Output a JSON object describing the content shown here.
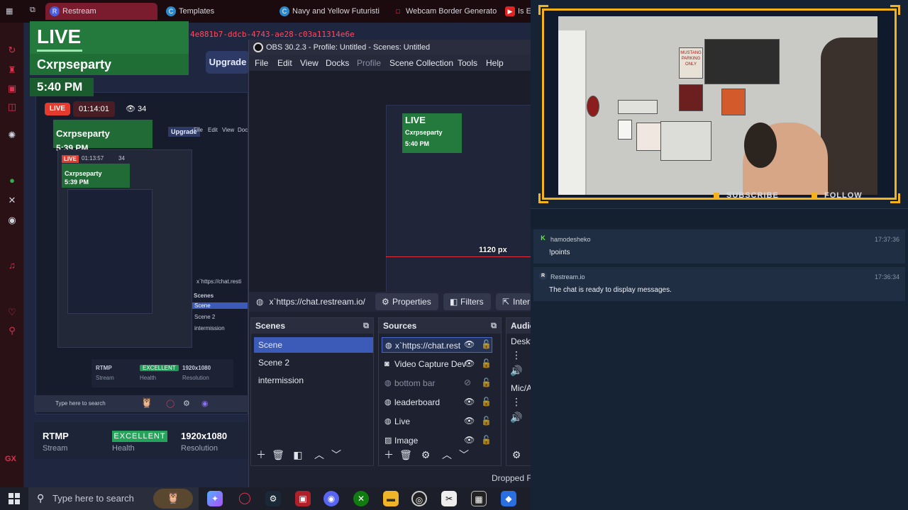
{
  "browser": {
    "tabs": [
      {
        "label": "Restream",
        "icon": "R"
      },
      {
        "label": "Templates",
        "icon": "C"
      },
      {
        "label": "Navy and Yellow Futuristi",
        "icon": "C"
      },
      {
        "label": "Webcam Border Generato",
        "icon": "□"
      },
      {
        "label": "Is E",
        "icon": "▶"
      }
    ],
    "url_fragment": "4e881b7-ddcb-4743-ae28-c03a11314e6e",
    "upgrade_label": "Upgrade"
  },
  "live_overlay": {
    "live_word": "LIVE",
    "channel": "Cxrpseparty",
    "time": "5:40 PM"
  },
  "nested": {
    "live_badge": "LIVE",
    "timer": "01:14:01",
    "viewers": "34",
    "channel": "Cxrpseparty",
    "time": "5:39 PM",
    "upgrade_label": "Upgrade",
    "menu": [
      "File",
      "Edit",
      "View",
      "Dock"
    ],
    "inner_timer": "01:13:57",
    "inner_viewers": "34",
    "inner_live": "LIVE",
    "inner_channel": "Cxrpseparty",
    "inner_time": "5:39 PM",
    "inner_source": "x`https://chat.resti",
    "inner_scenes_title": "Scenes",
    "inner_scenes": [
      "Scene",
      "Scene 2",
      "intermission"
    ],
    "rtmp": "RTMP",
    "stream": "Stream",
    "excellent": "EXCELLENT",
    "health": "Health",
    "resolution_value": "1920x1080",
    "resolution": "Resolution",
    "search": "Type here to search"
  },
  "stats": {
    "rtmp": "RTMP",
    "stream": "Stream",
    "excellent": "EXCELLENT",
    "health": "Health",
    "resolution_value": "1920x1080",
    "resolution": "Resolution"
  },
  "obs": {
    "title": "OBS 30.2.3 - Profile: Untitled - Scenes: Untitled",
    "menu": [
      "File",
      "Edit",
      "View",
      "Docks",
      "Profile",
      "Scene Collection",
      "Tools",
      "Help"
    ],
    "preview": {
      "live": "LIVE",
      "channel": "Cxrpseparty",
      "time": "5:40 PM",
      "size_label": "1120 px"
    },
    "selected_source": "x`https://chat.restream.io/",
    "properties_label": "Properties",
    "filters_label": "Filters",
    "interact_label": "Inter",
    "scenes_title": "Scenes",
    "scenes": [
      "Scene",
      "Scene 2",
      "intermission"
    ],
    "sources_title": "Sources",
    "sources": [
      {
        "label": "x`https://chat.rest",
        "icon": "globe"
      },
      {
        "label": "Video Capture Dev",
        "icon": "camera"
      },
      {
        "label": "bottom bar",
        "icon": "globe"
      },
      {
        "label": "leaderboard",
        "icon": "globe"
      },
      {
        "label": "Live",
        "icon": "globe"
      },
      {
        "label": "Image",
        "icon": "image"
      }
    ],
    "audio_title": "Audio",
    "audio_desktop": "Deskt",
    "audio_mic": "Mic/A",
    "dropped_frames": "Dropped Fi"
  },
  "taskbar": {
    "search_placeholder": "Type here to search"
  },
  "cam": {
    "subscribe": "SUBSCRIBE",
    "follow": "FOLLOW",
    "poster_text": "MUSTANG PARKING ONLY"
  },
  "chat": {
    "messages": [
      {
        "user": "hamodesheko",
        "time": "17:37:36",
        "text": "!points",
        "badge": "K"
      },
      {
        "user": "Restream.io",
        "time": "17:36:34",
        "text": "The chat is ready to display messages.",
        "badge": "R"
      }
    ]
  },
  "colors": {
    "accent_obs": "#3c5bb8",
    "live_green": "#237a3c",
    "cam_border": "#f5b21b",
    "opera_red": "#d8344f"
  }
}
